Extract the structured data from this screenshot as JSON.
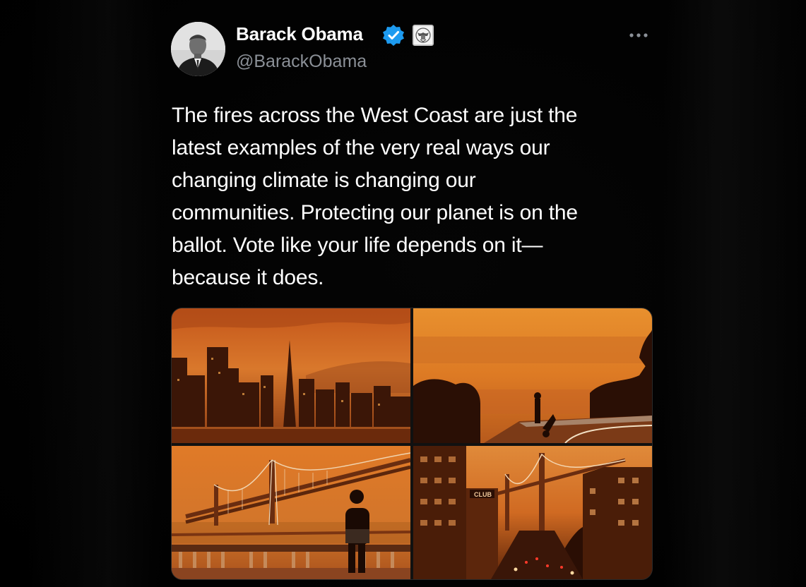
{
  "tweet": {
    "author": {
      "display_name": "Barack Obama",
      "handle": "@BarackObama",
      "avatar_icon": "profile-photo",
      "verified_icon": "verified-badge-icon",
      "affiliation_icon": "government-seal-icon"
    },
    "more_icon": "more-options-icon",
    "text_lines": [
      "The fires across the West Coast are just the",
      "latest examples of the very real ways our",
      "changing climate is changing our",
      "communities. Protecting our planet is on the",
      "ballot. Vote like your life depends on it—",
      "because it does."
    ],
    "media": [
      {
        "name": "photo-city-skyline",
        "sign_text": ""
      },
      {
        "name": "photo-bay-overlook",
        "sign_text": ""
      },
      {
        "name": "photo-bay-bridge-person",
        "sign_text": ""
      },
      {
        "name": "photo-street-bridge",
        "sign_text": "CLUB"
      }
    ]
  },
  "colors": {
    "background": "#000000",
    "text_primary": "#ffffff",
    "text_secondary": "#8b9097",
    "verified_blue": "#1d9bf0",
    "smoke_orange": "#e07a28"
  }
}
